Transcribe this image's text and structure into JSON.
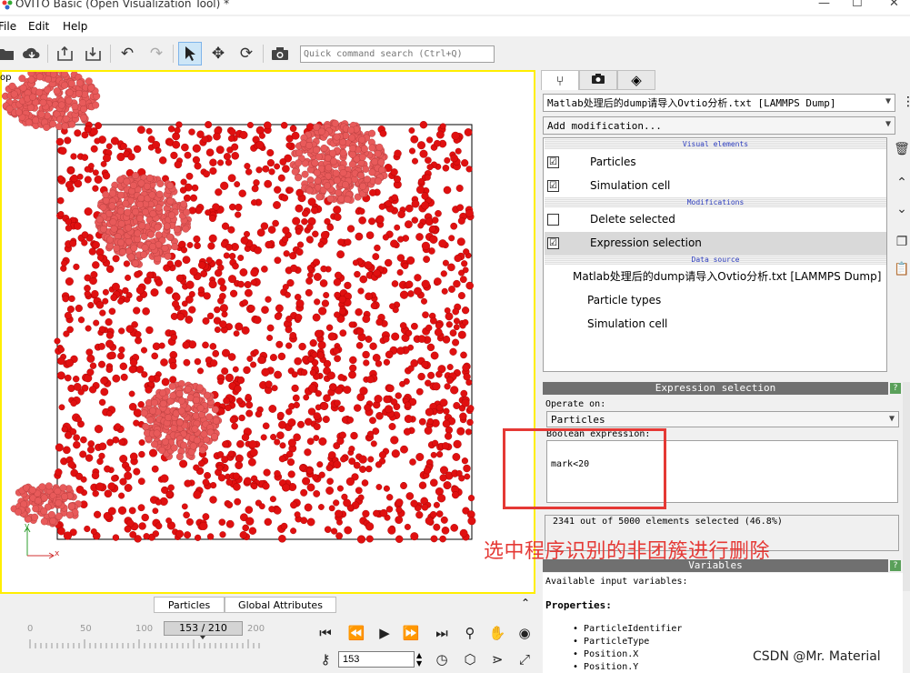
{
  "window": {
    "title": "OVITO Basic (Open Visualization Tool) *"
  },
  "menu": {
    "file": "File",
    "edit": "Edit",
    "help": "Help"
  },
  "toolbar": {
    "search_placeholder": "Quick command search (Ctrl+Q)"
  },
  "viewport": {
    "caption": "op"
  },
  "axes": {
    "y_label": "y",
    "x_label": "x"
  },
  "bottom_tabs": {
    "particles": "Particles",
    "global_attributes": "Global Attributes"
  },
  "timeline": {
    "ticks": [
      "0",
      "50",
      "100",
      "150",
      "200"
    ],
    "frame_display": "153 / 210",
    "frame_value": "153",
    "current_frame": 153,
    "max_frame": 210
  },
  "pipeline": {
    "source_combo": "Matlab处理后的dump请导入Ovtio分析.txt [LAMMPS Dump]",
    "add_modification": "Add modification...",
    "visual_elements_header": "Visual elements",
    "modifications_header": "Modifications",
    "data_source_header": "Data source",
    "visual_items": [
      {
        "label": "Particles",
        "checked": "☑"
      },
      {
        "label": "Simulation cell",
        "checked": "☑"
      }
    ],
    "modification_items": [
      {
        "label": "Delete selected",
        "checked": ""
      },
      {
        "label": "Expression selection",
        "checked": "☑"
      }
    ],
    "data_source_items": [
      {
        "label": "Matlab处理后的dump请导入Ovtio分析.txt [LAMMPS Dump]"
      },
      {
        "label": "Particle types"
      },
      {
        "label": "Simulation cell"
      }
    ]
  },
  "expression_panel": {
    "title": "Expression selection",
    "help": "?",
    "operate_on_label": "Operate on:",
    "operate_on_value": "Particles",
    "boolean_label": "Boolean expression:",
    "expression": "mark<20",
    "status": "2341 out of 5000 elements selected (46.8%)"
  },
  "variables_panel": {
    "title": "Variables",
    "help": "?",
    "available": "Available input variables:",
    "properties_label": "Properties:",
    "properties": [
      "ParticleIdentifier",
      "ParticleType",
      "Position.X",
      "Position.Y"
    ]
  },
  "annotation": "选中程序识别的非团簇进行删除",
  "watermark": "CSDN @Mr. Material",
  "colors": {
    "particle": "#e01010",
    "cluster": "#e85a5a",
    "highlight": "#ffee00",
    "annotation": "#e53935"
  }
}
